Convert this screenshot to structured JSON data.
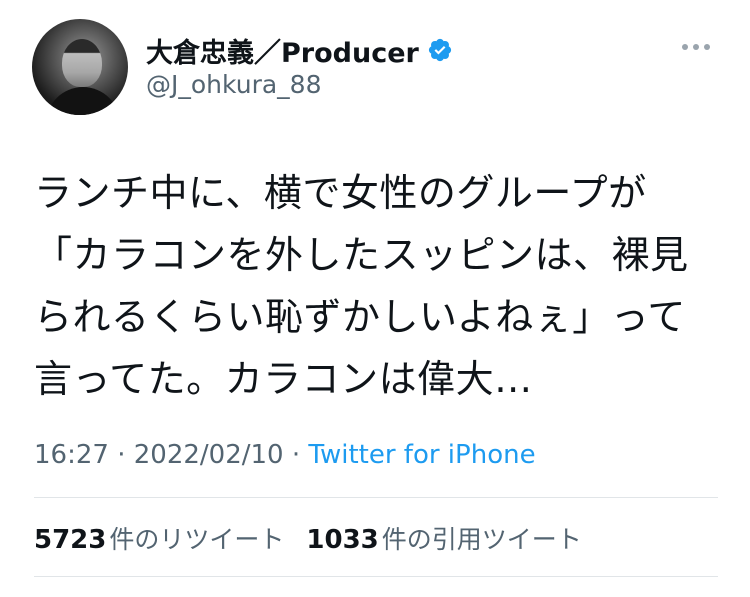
{
  "author": {
    "display_name": "大倉忠義／Producer",
    "handle": "@J_ohkura_88",
    "verified_icon": "verified-badge-icon",
    "verified_color": "#1d9bf0"
  },
  "tweet": {
    "lines": [
      "ランチ中に、横で女性のグループが",
      "「カラコンを外したスッピンは、裸見",
      "られるくらい恥ずかしいよねぇ」って",
      "言ってた。カラコンは偉大…"
    ]
  },
  "meta": {
    "time": "16:27",
    "separator": "·",
    "date": "2022/02/10",
    "source": "Twitter for iPhone"
  },
  "stats": {
    "retweets_count": "5723",
    "retweets_label": "件のリツイート",
    "quotes_count": "1033",
    "quotes_label": "件の引用ツイート"
  },
  "colors": {
    "text": "#0f1419",
    "secondary": "#536471",
    "link": "#1d9bf0",
    "divider": "#e1e5e8"
  }
}
